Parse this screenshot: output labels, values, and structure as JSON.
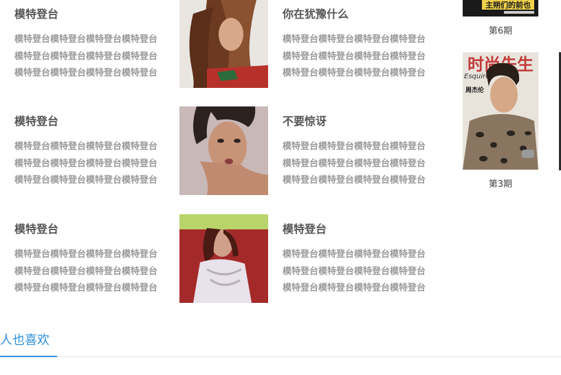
{
  "rows": [
    {
      "left": {
        "title": "模特登台",
        "body": "模特登台模特登台模特登台模特登台模特登台模特登台模特登台模特登台模特登台模特登台模特登台模特登台"
      },
      "photo_alt": "模特",
      "right": {
        "title": "你在犹豫什么",
        "body": "模特登台模特登台模特登台模特登台模特登台模特登台模特登台模特登台模特登台模特登台模特登台模特登台"
      }
    },
    {
      "left": {
        "title": "模特登台",
        "body": "模特登台模特登台模特登台模特登台模特登台模特登台模特登台模特登台模特登台模特登台模特登台模特登台"
      },
      "photo_alt": "模特",
      "right": {
        "title": "不要惊讶",
        "body": "模特登台模特登台模特登台模特登台模特登台模特登台模特登台模特登台模特登台模特登台模特登台模特登台"
      }
    },
    {
      "left": {
        "title": "模特登台",
        "body": "模特登台模特登台模特登台模特登台模特登台模特登台模特登台模特登台模特登台模特登台模特登台模特登台"
      },
      "photo_alt": "模特",
      "right": {
        "title": "模特登台",
        "body": "模特登台模特登台模特登台模特登台模特登台模特登台模特登台模特登台模特登台模特登台模特登台模特登台"
      }
    }
  ],
  "magazines": [
    {
      "label": "第6期",
      "cover_text": "主朔们的前也"
    },
    {
      "label": "第3期",
      "cover_text": "时尚先生",
      "cover_subtext": "Esquire",
      "cover_name": "周杰伦"
    }
  ],
  "section": {
    "tab_label": "人也喜欢"
  },
  "colors": {
    "accent": "#2e8fe0",
    "title": "#555555",
    "body": "#9a9a9a",
    "divider": "#e6e6e6"
  }
}
